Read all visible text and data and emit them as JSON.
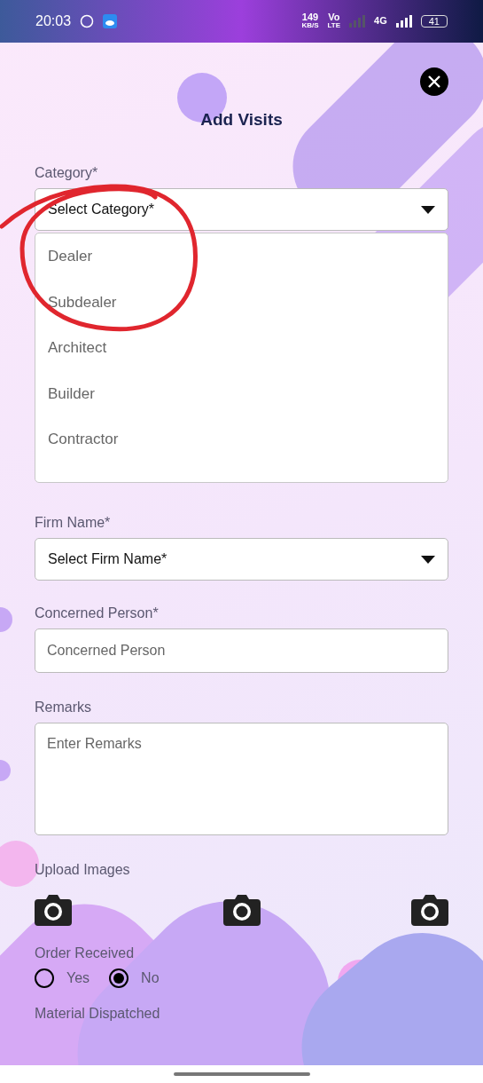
{
  "status_bar": {
    "time": "20:03",
    "speed": "149",
    "speed_unit": "KB/S",
    "volte": "Vo",
    "volte_sub": "LTE",
    "network": "4G",
    "battery": "41"
  },
  "title": "Add Visits",
  "category": {
    "label": "Category*",
    "placeholder": "Select Category*",
    "expanded": true,
    "options": [
      {
        "label": "Dealer"
      },
      {
        "label": "Subdealer"
      },
      {
        "label": "Architect"
      },
      {
        "label": "Builder"
      },
      {
        "label": "Contractor"
      }
    ]
  },
  "firm_name": {
    "label": "Firm Name*",
    "placeholder": "Select Firm Name*"
  },
  "concerned_person": {
    "label": "Concerned Person*",
    "placeholder": "Concerned Person"
  },
  "remarks": {
    "label": "Remarks",
    "placeholder": "Enter Remarks"
  },
  "upload_images": {
    "label": "Upload Images"
  },
  "order_received": {
    "label": "Order Received",
    "options": [
      {
        "label": "Yes",
        "selected": false
      },
      {
        "label": "No",
        "selected": true
      }
    ]
  },
  "material_dispatched": {
    "label": "Material Dispatched"
  }
}
